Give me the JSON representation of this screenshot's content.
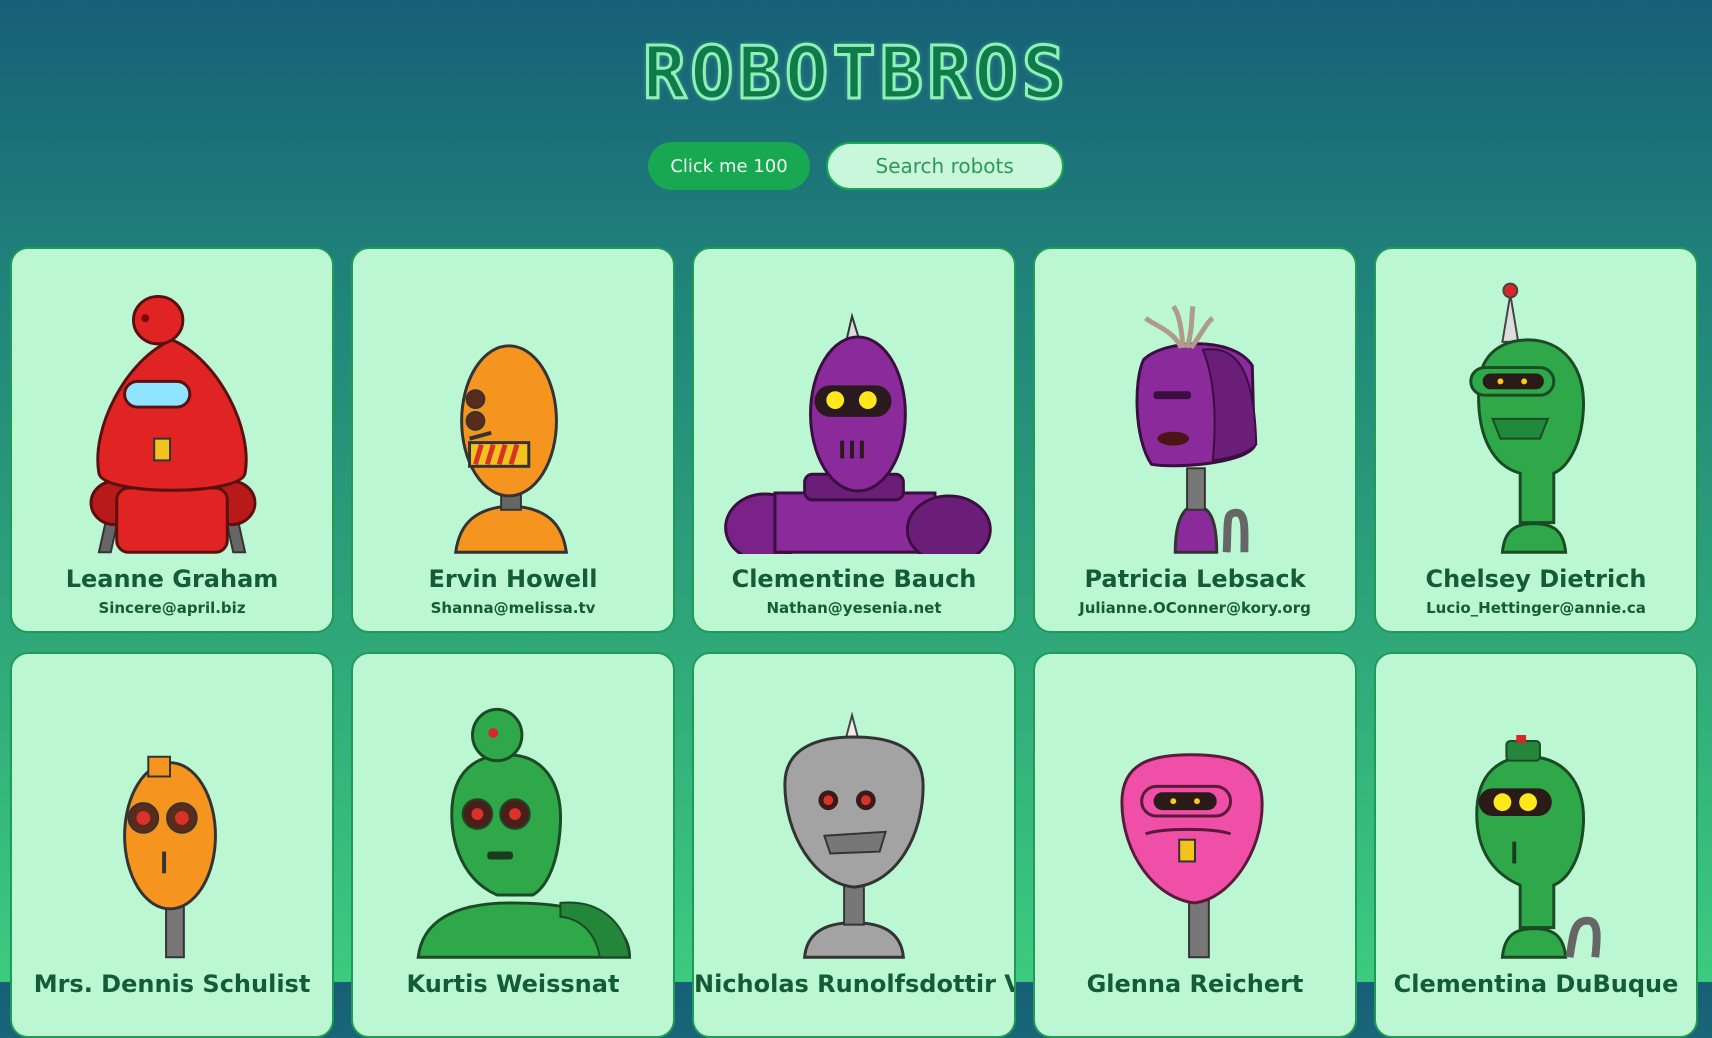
{
  "app": {
    "logo": "ROBOTBROS",
    "click_button_label": "Click me 100",
    "search_placeholder": "Search robots"
  },
  "robots": [
    {
      "name": "Leanne Graham",
      "email": "Sincere@april.biz",
      "color": "#e02424"
    },
    {
      "name": "Ervin Howell",
      "email": "Shanna@melissa.tv",
      "color": "#f5951f"
    },
    {
      "name": "Clementine Bauch",
      "email": "Nathan@yesenia.net",
      "color": "#8b2a9a"
    },
    {
      "name": "Patricia Lebsack",
      "email": "Julianne.OConner@kory.org",
      "color": "#8b2a9a"
    },
    {
      "name": "Chelsey Dietrich",
      "email": "Lucio_Hettinger@annie.ca",
      "color": "#2fa84a"
    },
    {
      "name": "Mrs. Dennis Schulist",
      "email": "",
      "color": "#f5951f"
    },
    {
      "name": "Kurtis Weissnat",
      "email": "",
      "color": "#2fa84a"
    },
    {
      "name": "Nicholas Runolfsdottir V",
      "email": "",
      "color": "#a3a3a3"
    },
    {
      "name": "Glenna Reichert",
      "email": "",
      "color": "#f04fa8"
    },
    {
      "name": "Clementina DuBuque",
      "email": "",
      "color": "#2fa84a"
    }
  ]
}
